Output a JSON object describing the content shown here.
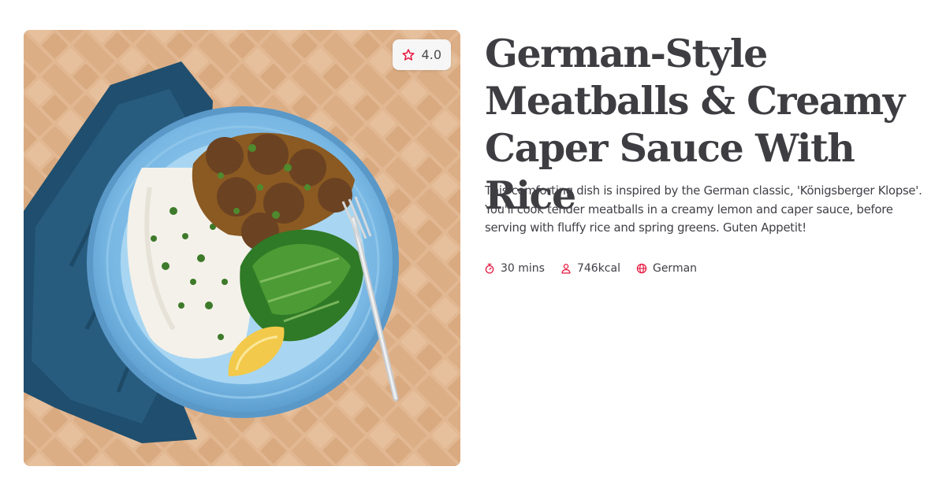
{
  "recipe": {
    "title": "German-Style Meatballs & Creamy Caper Sauce With Rice",
    "description": "This comforting dish is inspired by the German classic, 'Königsberger Klopse'. You'll cook tender meatballs in a creamy lemon and caper sauce, before serving with fluffy rice and spring greens. Guten Appetit!",
    "rating": "4.0",
    "meta": {
      "time": "30 mins",
      "calories": "746kcal",
      "cuisine": "German"
    }
  },
  "icons": {
    "rating": "star-outline-icon",
    "time": "stopwatch-icon",
    "calories": "person-icon",
    "cuisine": "globe-icon"
  },
  "colors": {
    "accent": "#e8173f",
    "title": "#3e3e42",
    "body_text": "#3f3f46"
  }
}
